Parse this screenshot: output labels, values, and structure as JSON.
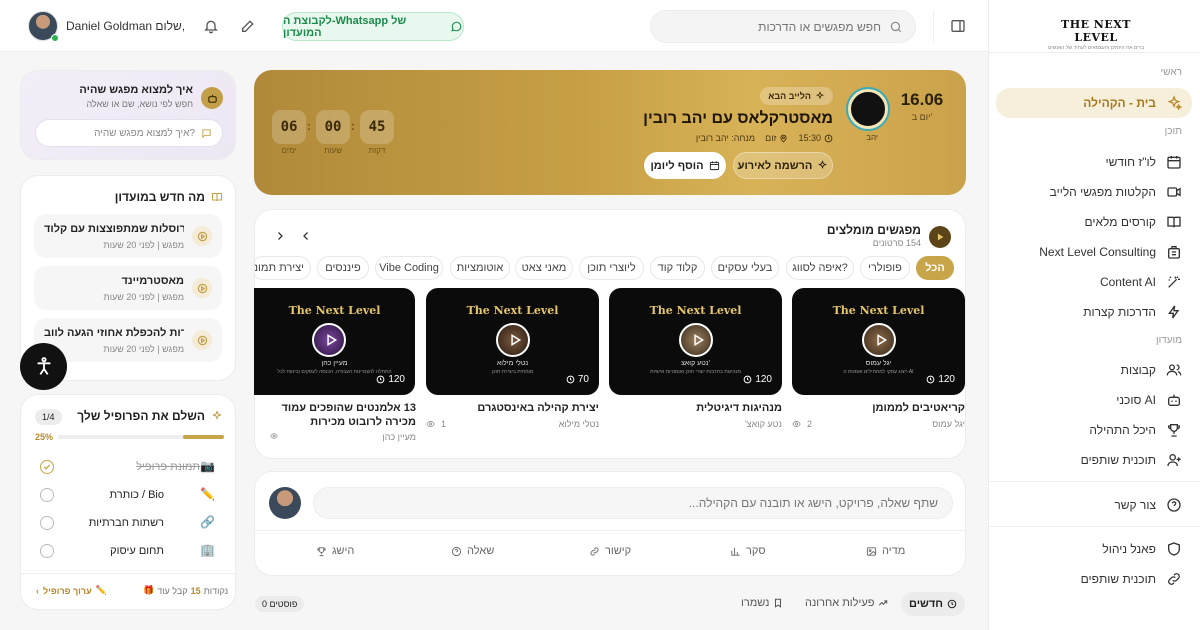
{
  "brand": {
    "name": "THE NEXT LEVEL",
    "tagline": "מחברים את היזמים והעצמאים לעתיד של האנשים"
  },
  "colors": {
    "accent": "#c9a54a",
    "whatsapp": "#1a8a4a"
  },
  "topbar": {
    "search_placeholder": "חפש מפגשים או הדרכות",
    "whatsapp_label": "לקבוצת ה-Whatsapp של המועדון",
    "greeting": "שלום,",
    "user_name": "Daniel Goldman"
  },
  "sidebar": {
    "sections": [
      {
        "title": "ראשי"
      },
      {
        "title": "תוכן"
      },
      {
        "title": "מועדון"
      }
    ],
    "items": [
      {
        "label": "בית - הקהילה",
        "icon": "sparkles-icon",
        "active": true
      },
      {
        "label": "לו\"ז חודשי",
        "icon": "calendar-icon"
      },
      {
        "label": "הקלטות מפגשי הלייב",
        "icon": "video-icon"
      },
      {
        "label": "קורסים מלאים",
        "icon": "book-icon"
      },
      {
        "label": "Next Level Consulting",
        "icon": "building-icon"
      },
      {
        "label": "Content AI",
        "icon": "wand-icon"
      },
      {
        "label": "הדרכות קצרות",
        "icon": "bolt-icon"
      },
      {
        "label": "קבוצות",
        "icon": "users-icon"
      },
      {
        "label": "סוכני AI",
        "icon": "bot-icon"
      },
      {
        "label": "היכל התהילה",
        "icon": "trophy-icon"
      },
      {
        "label": "תוכנית שותפים",
        "icon": "user-plus-icon"
      },
      {
        "label": "צור קשר",
        "icon": "help-icon"
      },
      {
        "label": "פאנל ניהול",
        "icon": "shield-icon"
      },
      {
        "label": "תוכנית שותפים",
        "icon": "link-icon"
      }
    ]
  },
  "hero": {
    "badge": "הלייב הבא",
    "title": "מאסטרקלאס עם יהב רובין",
    "date": "16.06",
    "day": "יום ב'",
    "time": "15:30",
    "location": "זום",
    "host_label": "מנחה: יהב רובין",
    "avatar_caption": "יהב",
    "register_label": "הרשמה לאירוע",
    "calendar_label": "הוסף ליומן",
    "countdown": [
      {
        "value": "45",
        "label": "דקות"
      },
      {
        "value": "00",
        "label": "שעות"
      },
      {
        "value": "06",
        "label": "ימים"
      }
    ]
  },
  "featured": {
    "title": "מפגשים מומלצים",
    "subtitle": "154 סרטונים",
    "filters": [
      "הכל",
      "פופולרי",
      "איפה לסווג?",
      "בעלי עסקים",
      "קלוד קוד",
      "ליוצרי תוכן",
      "מאני צאט",
      "אוטומציות",
      "Vibe Coding",
      "פיננסים",
      "יצירת תמונ"
    ],
    "videos": [
      {
        "brand": "The Next Level",
        "presenter": "יגל עמוס",
        "desc": "ייצוג עסקי למתחילים ואמנות ה-AI",
        "count": "120",
        "title": "קריאטיבים לממומן",
        "author": "יגל עמוס",
        "views": "2"
      },
      {
        "brand": "The Next Level",
        "presenter": "נטע קואצ'",
        "desc": "מנהיגות בתרבות יוצרי תוכן ואומנויות אישיות",
        "count": "120",
        "title": "מנהיגות דיגיטלית",
        "author": "נטע קואצ'",
        "views": ""
      },
      {
        "brand": "The Next Level",
        "presenter": "נטלי מילוא",
        "desc": "מומחית ביצירת תוכן",
        "count": "70",
        "title": "יצירת קהילה באינסטגרם",
        "author": "נטלי מילוא",
        "views": "1"
      },
      {
        "brand": "The Next Level",
        "presenter": "מעיין כהן",
        "desc": "התחלה להצטיינות העבודה, הכנסה לעסקים וביטוח לכל",
        "count": "120",
        "title": "13 אלמנטים שהופכים עמוד מכירה לרובוט מכירות",
        "author": "מעיין כהן",
        "views": "1"
      }
    ]
  },
  "composer": {
    "placeholder": "שתף שאלה, פרויקט, הישג או תובנה עם הקהילה...",
    "actions": [
      {
        "label": "מדיה",
        "icon": "image-icon"
      },
      {
        "label": "סקר",
        "icon": "poll-icon"
      },
      {
        "label": "קישור",
        "icon": "link-icon"
      },
      {
        "label": "שאלה",
        "icon": "question-icon"
      },
      {
        "label": "הישג",
        "icon": "trophy-icon"
      }
    ]
  },
  "feed_tabs": {
    "new": "חדשים",
    "recent": "פעילות אחרונה",
    "saved": "נשמרו",
    "count": "0 פוסטים"
  },
  "finder": {
    "title": "איך למצוא מפגש שהיה",
    "subtitle": "חפש לפי נושא, שם או שאלה",
    "placeholder": "איך למצוא מפגש שהיה?"
  },
  "whats_new": {
    "title": "מה חדש במועדון",
    "items": [
      {
        "title": "קרוסלות שמתפוצצות עם קלוד ...",
        "meta": "מפגש | לפני 20 שעות"
      },
      {
        "title": "מאסטרמיינד",
        "meta": "מפגש | לפני 20 שעות"
      },
      {
        "title": "סודות להכפלת אחוזי הגעה לווב...",
        "meta": "מפגש | לפני 20 שעות"
      }
    ]
  },
  "profile": {
    "title": "השלם את הפרופיל שלך",
    "step": "1/4",
    "percent": "25%",
    "progress": 0.25,
    "tasks": [
      {
        "label": "תמונת פרופיל",
        "done": true
      },
      {
        "label": "כותרת / Bio",
        "done": false
      },
      {
        "label": "רשתות חברתיות",
        "done": false
      },
      {
        "label": "תחום עיסוק",
        "done": false
      }
    ],
    "reward_prefix": "קבל עוד",
    "reward_points": "15",
    "reward_suffix": "נקודות",
    "edit_label": "ערוך פרופיל"
  }
}
